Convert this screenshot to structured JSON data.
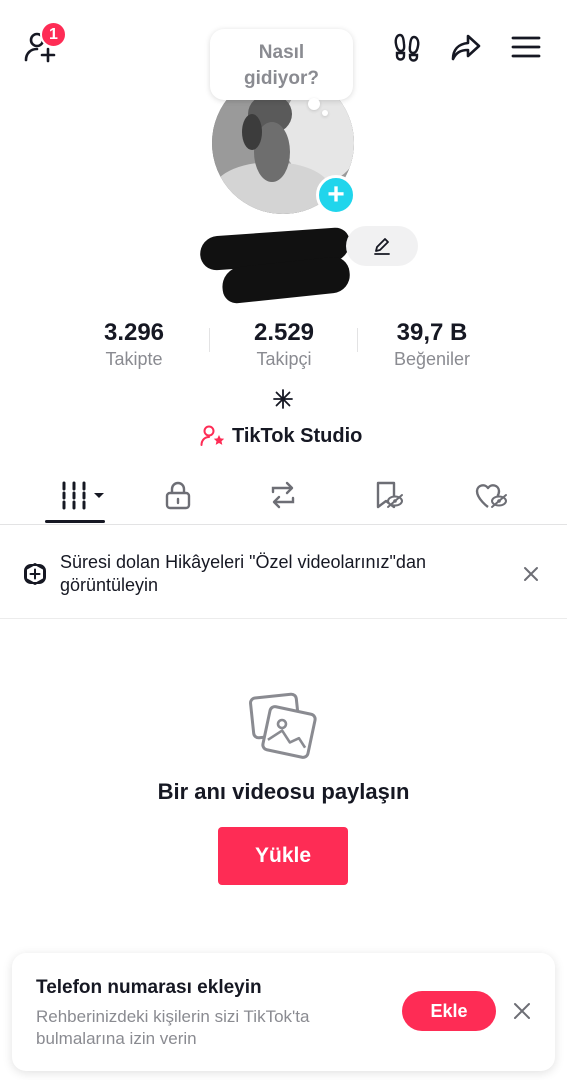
{
  "header": {
    "add_friend_badge": "1",
    "icons": [
      "add-friend-icon",
      "footprints-icon",
      "share-icon",
      "menu-icon"
    ]
  },
  "bubble": {
    "text_line1": "Nasıl",
    "text_line2": "gidiyor?"
  },
  "profile": {
    "avatar_plus": "+"
  },
  "stats": [
    {
      "value": "3.296",
      "label": "Takipte"
    },
    {
      "value": "2.529",
      "label": "Takipçi"
    },
    {
      "value": "39,7 B",
      "label": "Beğeniler"
    }
  ],
  "studio": {
    "label": "TikTok Studio"
  },
  "tabs": [
    {
      "icon": "videos-grid-icon",
      "active": true
    },
    {
      "icon": "lock-icon",
      "active": false
    },
    {
      "icon": "repost-icon",
      "active": false
    },
    {
      "icon": "favorites-hidden-icon",
      "active": false
    },
    {
      "icon": "liked-hidden-icon",
      "active": false
    }
  ],
  "notice": {
    "text": "Süresi dolan Hikâyeleri \"Özel videolarınız\"dan görüntüleyin"
  },
  "empty_state": {
    "title": "Bir anı videosu paylaşın",
    "button": "Yükle"
  },
  "phone_card": {
    "title": "Telefon numarası ekleyin",
    "subtitle": "Rehberinizdeki kişilerin sizi TikTok'ta bulmalarına izin verin",
    "button": "Ekle"
  },
  "colors": {
    "accent": "#fe2c55",
    "avatar_plus": "#20d5ec",
    "secondary_text": "#8a8b91"
  }
}
